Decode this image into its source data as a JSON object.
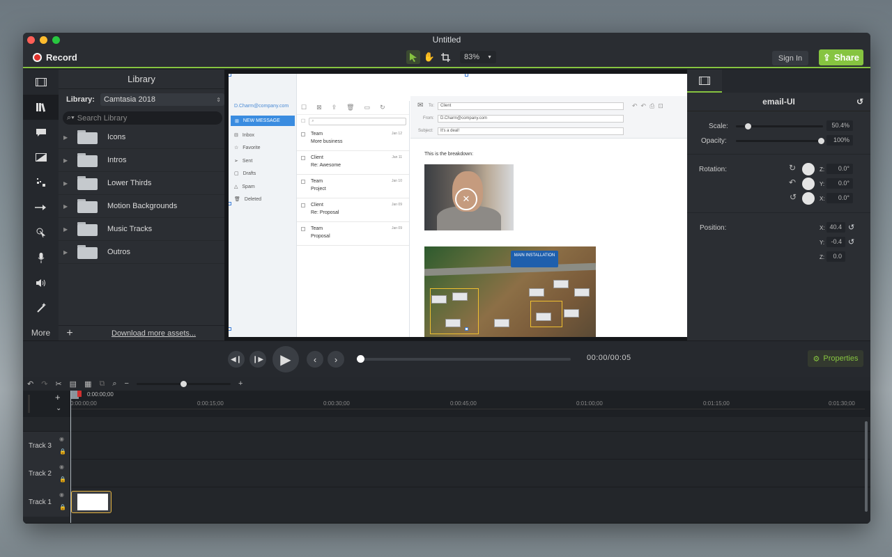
{
  "window": {
    "title": "Untitled"
  },
  "toolbar": {
    "record_label": "Record",
    "zoom": "83%",
    "signin_label": "Sign In",
    "share_label": "Share"
  },
  "sidebar": {
    "more_label": "More"
  },
  "library": {
    "title": "Library",
    "library_label": "Library:",
    "selected": "Camtasia 2018",
    "search_placeholder": "Search Library",
    "folders": [
      {
        "label": "Icons"
      },
      {
        "label": "Intros"
      },
      {
        "label": "Lower Thirds"
      },
      {
        "label": "Motion Backgrounds"
      },
      {
        "label": "Music Tracks"
      },
      {
        "label": "Outros"
      }
    ],
    "download_link": "Download more assets..."
  },
  "canvas": {
    "mail": {
      "account": "D.Charm@company.com",
      "new_message": "NEW MESSAGE",
      "nav": [
        "Inbox",
        "Favorite",
        "Sent",
        "Drafts",
        "Spam",
        "Deleted"
      ],
      "messages": [
        {
          "from": "Team",
          "subject": "More business",
          "date": "Jan 12"
        },
        {
          "from": "Client",
          "subject": "Re: Awesome",
          "date": "Jan 11"
        },
        {
          "from": "Team",
          "subject": "Project",
          "date": "Jan 10"
        },
        {
          "from": "Client",
          "subject": "Re: Proposal",
          "date": "Jan 09"
        },
        {
          "from": "Team",
          "subject": "Proposal",
          "date": "Jan 09"
        }
      ],
      "to_label": "To:",
      "to_value": "Client",
      "from_label": "From:",
      "from_value": "D.Charm@company.com",
      "subject_label": "Subject:",
      "subject_value": "It's a deal!",
      "body": "This is the breakdown:",
      "image_label": "MAIN INSTALLATION"
    }
  },
  "properties": {
    "title": "email-UI",
    "scale_label": "Scale:",
    "scale_value": "50.4%",
    "scale_fraction": 0.04,
    "opacity_label": "Opacity:",
    "opacity_value": "100%",
    "rotation_label": "Rotation:",
    "rotation": [
      {
        "axis": "Z:",
        "value": "0.0°"
      },
      {
        "axis": "Y:",
        "value": "0.0°"
      },
      {
        "axis": "X:",
        "value": "0.0°"
      }
    ],
    "position_label": "Position:",
    "position": [
      {
        "axis": "X:",
        "value": "40.4"
      },
      {
        "axis": "Y:",
        "value": "-0.4"
      },
      {
        "axis": "Z:",
        "value": "0.0"
      }
    ],
    "properties_button": "Properties"
  },
  "player": {
    "time": "00:00/00:05"
  },
  "timeline": {
    "playhead_time": "0:00:00;00",
    "ruler": [
      "0:00:00;00",
      "0:00:15;00",
      "0:00:30;00",
      "0:00:45;00",
      "0:01:00;00",
      "0:01:15;00",
      "0:01:30;00"
    ],
    "tracks": [
      {
        "label": "Track 3"
      },
      {
        "label": "Track 2"
      },
      {
        "label": "Track 1"
      }
    ]
  },
  "colors": {
    "accent": "#86c440",
    "record": "#e0322d",
    "clip_border": "#e6b440"
  }
}
